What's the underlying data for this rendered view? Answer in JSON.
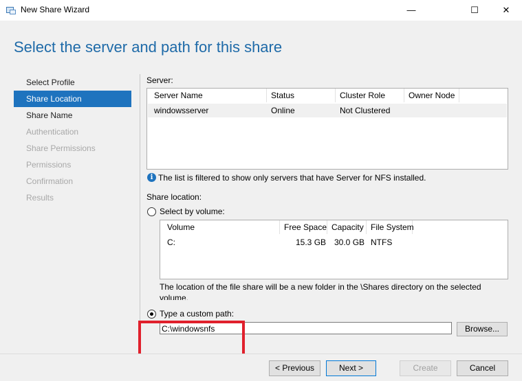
{
  "window": {
    "title": "New Share Wizard",
    "minimize_glyph": "—",
    "maximize_glyph": "☐",
    "close_glyph": "✕",
    "icon": "share-wizard-icon"
  },
  "page": {
    "heading": "Select the server and path for this share"
  },
  "nav": {
    "items": [
      {
        "label": "Select Profile",
        "state": "normal"
      },
      {
        "label": "Share Location",
        "state": "active"
      },
      {
        "label": "Share Name",
        "state": "normal"
      },
      {
        "label": "Authentication",
        "state": "disabled"
      },
      {
        "label": "Share Permissions",
        "state": "disabled"
      },
      {
        "label": "Permissions",
        "state": "disabled"
      },
      {
        "label": "Confirmation",
        "state": "disabled"
      },
      {
        "label": "Results",
        "state": "disabled"
      }
    ]
  },
  "server": {
    "label": "Server:",
    "columns": [
      "Server Name",
      "Status",
      "Cluster Role",
      "Owner Node"
    ],
    "rows": [
      {
        "server_name": "windowsserver",
        "status": "Online",
        "cluster_role": "Not Clustered",
        "owner_node": ""
      }
    ],
    "info_text": "The list is filtered to show only servers that have Server for NFS installed."
  },
  "share_location": {
    "label": "Share location:",
    "by_volume_label": "Select by volume:",
    "volume_columns": [
      "Volume",
      "Free Space",
      "Capacity",
      "File System"
    ],
    "volumes": [
      {
        "volume": "C:",
        "free_space": "15.3 GB",
        "capacity": "30.0 GB",
        "file_system": "NTFS"
      }
    ],
    "volume_note_line1": "The location of the file share will be a new folder in the \\Shares directory on the selected",
    "volume_note_line2": "volume.",
    "custom_path_label": "Type a custom path:",
    "custom_path_value": "C:\\windowsnfs",
    "browse_label": "Browse...",
    "selected_option": "custom_path"
  },
  "footer": {
    "previous_label": "< Previous",
    "next_label": "Next >",
    "create_label": "Create",
    "cancel_label": "Cancel"
  },
  "colors": {
    "heading": "#1e6aa8",
    "nav_active": "#1e73be",
    "highlight_box": "#e0202c"
  }
}
